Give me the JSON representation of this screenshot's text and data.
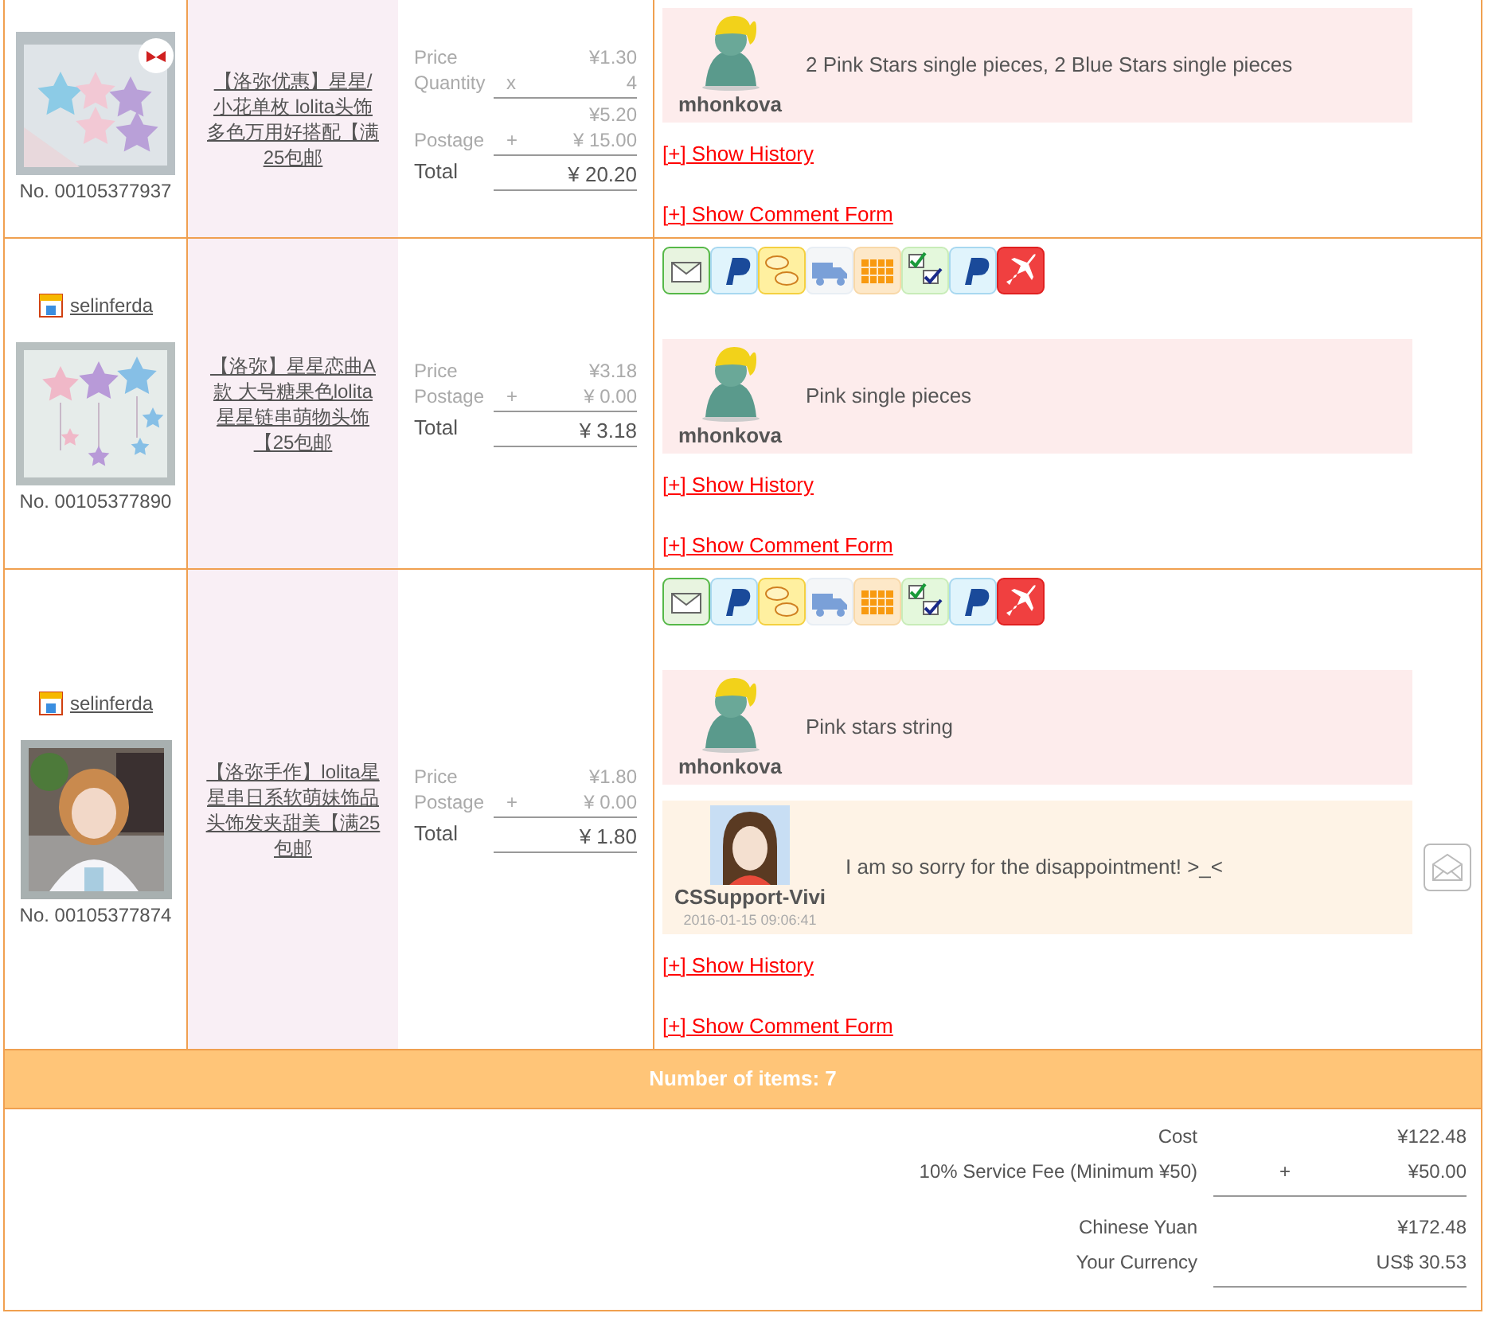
{
  "items": [
    {
      "number": "No. 00105377937",
      "title": "【洛弥优惠】星星/小花单枚 lolita头饰多色万用好搭配【满25包邮",
      "picture": {
        "kind": "picture"
      },
      "prices": [
        {
          "kind": "line",
          "label": "Price",
          "value": "¥1.30"
        },
        {
          "kind": "line",
          "label": "Quantity",
          "op": "x",
          "value": "4"
        },
        {
          "kind": "subtotal",
          "value": "¥5.20"
        },
        {
          "kind": "line",
          "label": "Postage",
          "op": "+",
          "value": "¥ 15.00"
        },
        {
          "kind": "total",
          "label": "Total",
          "value": "¥ 20.20"
        }
      ],
      "toolbar": false,
      "comments": [
        {
          "kind": "customer",
          "author": "mhonkova",
          "text": "2 Pink Stars single pieces, 2 Blue Stars single pieces"
        }
      ],
      "history_link": "[+] Show History",
      "comment_link": "[+] Show Comment Form"
    },
    {
      "seller": "selinferda",
      "number": "No. 00105377890",
      "title": "【洛弥】星星恋曲A款 大号糖果色lolita星星链串萌物头饰【25包邮",
      "picture": {
        "kind": "picture"
      },
      "prices": [
        {
          "kind": "line",
          "label": "Price",
          "value": "¥3.18"
        },
        {
          "kind": "line",
          "label": "Postage",
          "op": "+",
          "value": "¥ 0.00"
        },
        {
          "kind": "total",
          "label": "Total",
          "value": "¥ 3.18"
        }
      ],
      "toolbar": true,
      "comments": [
        {
          "kind": "customer",
          "author": "mhonkova",
          "text": "Pink single pieces"
        }
      ],
      "history_link": "[+] Show History",
      "comment_link": "[+] Show Comment Form"
    },
    {
      "seller": "selinferda",
      "number": "No. 00105377874",
      "title": "【洛弥手作】lolita星星串日系软萌妹饰品头饰发夹甜美【满25包邮",
      "picture": {
        "kind": "picture"
      },
      "prices": [
        {
          "kind": "line",
          "label": "Price",
          "value": "¥1.80"
        },
        {
          "kind": "line",
          "label": "Postage",
          "op": "+",
          "value": "¥ 0.00"
        },
        {
          "kind": "total",
          "label": "Total",
          "value": "¥ 1.80"
        }
      ],
      "toolbar": true,
      "comments": [
        {
          "kind": "customer",
          "author": "mhonkova",
          "text": "Pink stars string"
        },
        {
          "kind": "support",
          "author": "CSSupport-Vivi",
          "text": "I am so sorry for the disappointment! >_<",
          "time": "2016-01-15 09:06:41"
        }
      ],
      "history_link": "[+] Show History",
      "comment_link": "[+] Show Comment Form"
    }
  ],
  "items_count": "Number of items: 7",
  "summary": [
    {
      "label": "Cost",
      "value": "¥122.48",
      "rule": false
    },
    {
      "label": "10% Service Fee (Minimum ¥50)",
      "op": "+",
      "value": "¥50.00",
      "rule": true
    },
    {
      "label": "Chinese Yuan",
      "value": "¥172.48",
      "rule": false
    },
    {
      "label": "Your Currency",
      "value": "US$ 30.53",
      "rule": true
    }
  ]
}
